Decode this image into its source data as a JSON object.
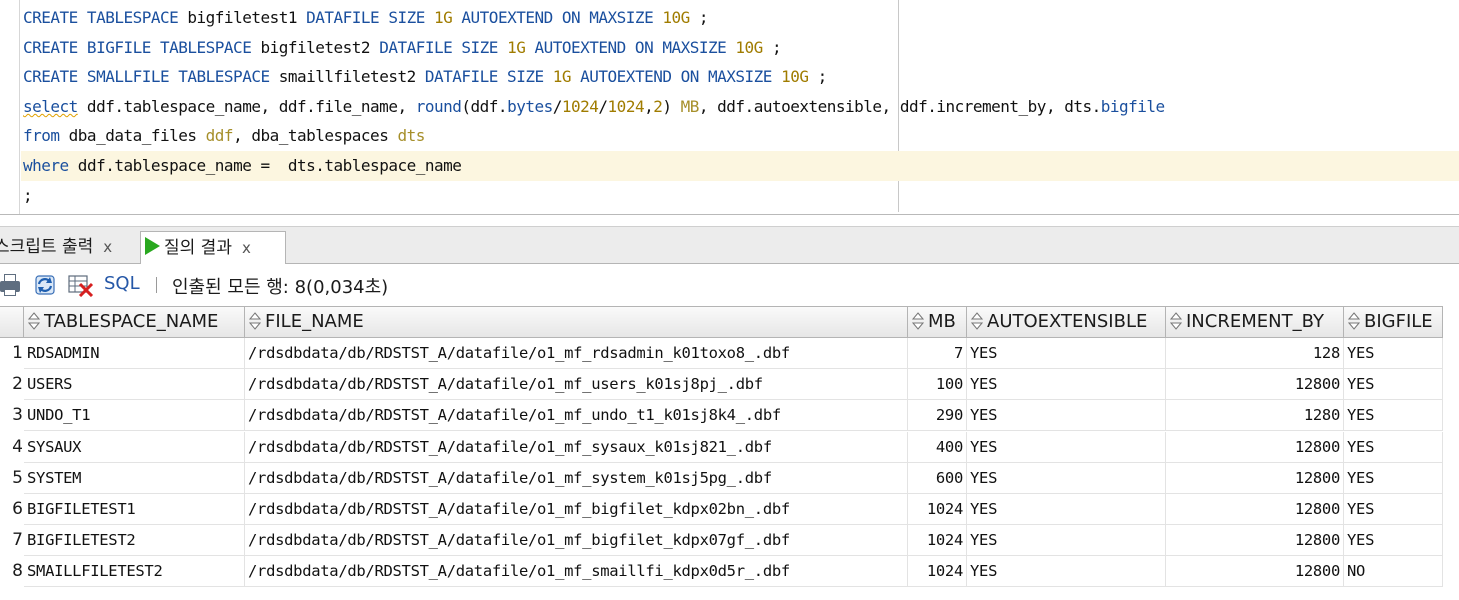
{
  "editor": {
    "lines": [
      {
        "tokens": [
          {
            "t": "CREATE TABLESPACE",
            "c": "kw"
          },
          {
            "t": " bigfiletest1 ",
            "c": ""
          },
          {
            "t": "DATAFILE SIZE",
            "c": "kw"
          },
          {
            "t": " ",
            "c": ""
          },
          {
            "t": "1G",
            "c": "num"
          },
          {
            "t": " ",
            "c": ""
          },
          {
            "t": "AUTOEXTEND ON MAXSIZE",
            "c": "kw"
          },
          {
            "t": " ",
            "c": ""
          },
          {
            "t": "10G",
            "c": "num"
          },
          {
            "t": " ;",
            "c": ""
          }
        ]
      },
      {
        "tokens": [
          {
            "t": "CREATE BIGFILE TABLESPACE",
            "c": "kw"
          },
          {
            "t": " bigfiletest2 ",
            "c": ""
          },
          {
            "t": "DATAFILE SIZE",
            "c": "kw"
          },
          {
            "t": " ",
            "c": ""
          },
          {
            "t": "1G",
            "c": "num"
          },
          {
            "t": " ",
            "c": ""
          },
          {
            "t": "AUTOEXTEND ON MAXSIZE",
            "c": "kw"
          },
          {
            "t": " ",
            "c": ""
          },
          {
            "t": "10G",
            "c": "num"
          },
          {
            "t": " ;",
            "c": ""
          }
        ]
      },
      {
        "tokens": [
          {
            "t": "CREATE SMALLFILE TABLESPACE",
            "c": "kw"
          },
          {
            "t": " smaillfiletest2 ",
            "c": ""
          },
          {
            "t": "DATAFILE SIZE",
            "c": "kw"
          },
          {
            "t": " ",
            "c": ""
          },
          {
            "t": "1G",
            "c": "num"
          },
          {
            "t": " ",
            "c": ""
          },
          {
            "t": "AUTOEXTEND ON MAXSIZE",
            "c": "kw"
          },
          {
            "t": " ",
            "c": ""
          },
          {
            "t": "10G",
            "c": "num"
          },
          {
            "t": " ;",
            "c": ""
          }
        ]
      },
      {
        "tokens": [
          {
            "t": "select",
            "c": "kw squiggle"
          },
          {
            "t": " ddf.tablespace_name, ddf.file_name, ",
            "c": ""
          },
          {
            "t": "round",
            "c": "fn"
          },
          {
            "t": "(ddf.",
            "c": ""
          },
          {
            "t": "bytes",
            "c": "kw"
          },
          {
            "t": "/",
            "c": ""
          },
          {
            "t": "1024",
            "c": "num"
          },
          {
            "t": "/",
            "c": ""
          },
          {
            "t": "1024",
            "c": "num"
          },
          {
            "t": ",",
            "c": ""
          },
          {
            "t": "2",
            "c": "num"
          },
          {
            "t": ") ",
            "c": ""
          },
          {
            "t": "MB",
            "c": "alias"
          },
          {
            "t": ", ddf.autoextensible, ddf.increment_by, dts.",
            "c": ""
          },
          {
            "t": "bigfile",
            "c": "kw"
          }
        ]
      },
      {
        "tokens": [
          {
            "t": "from",
            "c": "kw"
          },
          {
            "t": " dba_data_files ",
            "c": ""
          },
          {
            "t": "ddf",
            "c": "alias"
          },
          {
            "t": ", dba_tablespaces ",
            "c": ""
          },
          {
            "t": "dts",
            "c": "alias"
          }
        ]
      },
      {
        "current": true,
        "tokens": [
          {
            "t": "where",
            "c": "kw"
          },
          {
            "t": " ddf.tablespace_name =  dts.tablespace_name",
            "c": ""
          }
        ]
      },
      {
        "tokens": [
          {
            "t": ";",
            "c": ""
          }
        ]
      }
    ]
  },
  "tabs": {
    "script_output": {
      "label": "스크립트 출력",
      "close": "x"
    },
    "query_result": {
      "label": "질의 결과",
      "close": "x"
    }
  },
  "toolbar": {
    "sql_label": "SQL",
    "status": "인출된 모든 행: 8(0,034초)"
  },
  "grid": {
    "columns": [
      "TABLESPACE_NAME",
      "FILE_NAME",
      "MB",
      "AUTOEXTENSIBLE",
      "INCREMENT_BY",
      "BIGFILE"
    ],
    "rows": [
      [
        "1",
        "RDSADMIN",
        "/rdsdbdata/db/RDSTST_A/datafile/o1_mf_rdsadmin_k01toxo8_.dbf",
        "7",
        "YES",
        "128",
        "YES"
      ],
      [
        "2",
        "USERS",
        "/rdsdbdata/db/RDSTST_A/datafile/o1_mf_users_k01sj8pj_.dbf",
        "100",
        "YES",
        "12800",
        "YES"
      ],
      [
        "3",
        "UNDO_T1",
        "/rdsdbdata/db/RDSTST_A/datafile/o1_mf_undo_t1_k01sj8k4_.dbf",
        "290",
        "YES",
        "1280",
        "YES"
      ],
      [
        "4",
        "SYSAUX",
        "/rdsdbdata/db/RDSTST_A/datafile/o1_mf_sysaux_k01sj821_.dbf",
        "400",
        "YES",
        "12800",
        "YES"
      ],
      [
        "5",
        "SYSTEM",
        "/rdsdbdata/db/RDSTST_A/datafile/o1_mf_system_k01sj5pg_.dbf",
        "600",
        "YES",
        "12800",
        "YES"
      ],
      [
        "6",
        "BIGFILETEST1",
        "/rdsdbdata/db/RDSTST_A/datafile/o1_mf_bigfilet_kdpx02bn_.dbf",
        "1024",
        "YES",
        "12800",
        "YES"
      ],
      [
        "7",
        "BIGFILETEST2",
        "/rdsdbdata/db/RDSTST_A/datafile/o1_mf_bigfilet_kdpx07gf_.dbf",
        "1024",
        "YES",
        "12800",
        "YES"
      ],
      [
        "8",
        "SMAILLFILETEST2",
        "/rdsdbdata/db/RDSTST_A/datafile/o1_mf_smaillfi_kdpx0d5r_.dbf",
        "1024",
        "YES",
        "12800",
        "NO"
      ]
    ]
  }
}
